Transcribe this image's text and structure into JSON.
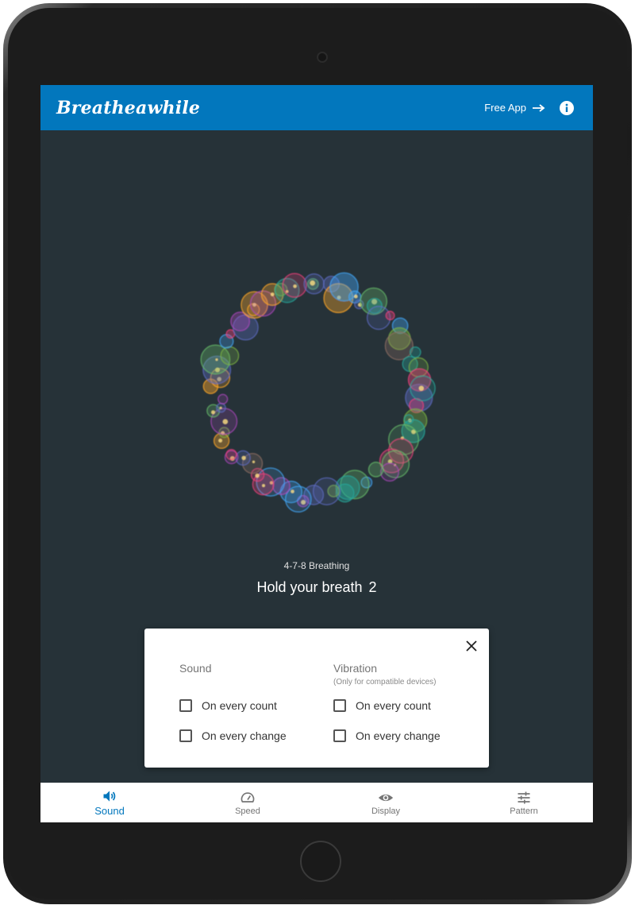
{
  "app_bar": {
    "logo": "Breatheawhile",
    "free_app_label": "Free App",
    "brand_color": "#0277bd"
  },
  "session": {
    "pattern_name": "4-7-8 Breathing",
    "instruction": "Hold your breath",
    "count": "2"
  },
  "sound_panel": {
    "sound": {
      "title": "Sound",
      "options": [
        "On every count",
        "On every change"
      ]
    },
    "vibration": {
      "title": "Vibration",
      "subtitle": "(Only for compatible devices)",
      "options": [
        "On every count",
        "On every change"
      ]
    }
  },
  "bottom_nav": {
    "items": [
      {
        "label": "Sound",
        "icon": "volume-icon",
        "active": true
      },
      {
        "label": "Speed",
        "icon": "speedometer-icon",
        "active": false
      },
      {
        "label": "Display",
        "icon": "eye-icon",
        "active": false
      },
      {
        "label": "Pattern",
        "icon": "sliders-icon",
        "active": false
      }
    ]
  },
  "colors": {
    "screen_bg": "#263238",
    "accent": "#0277bd"
  }
}
